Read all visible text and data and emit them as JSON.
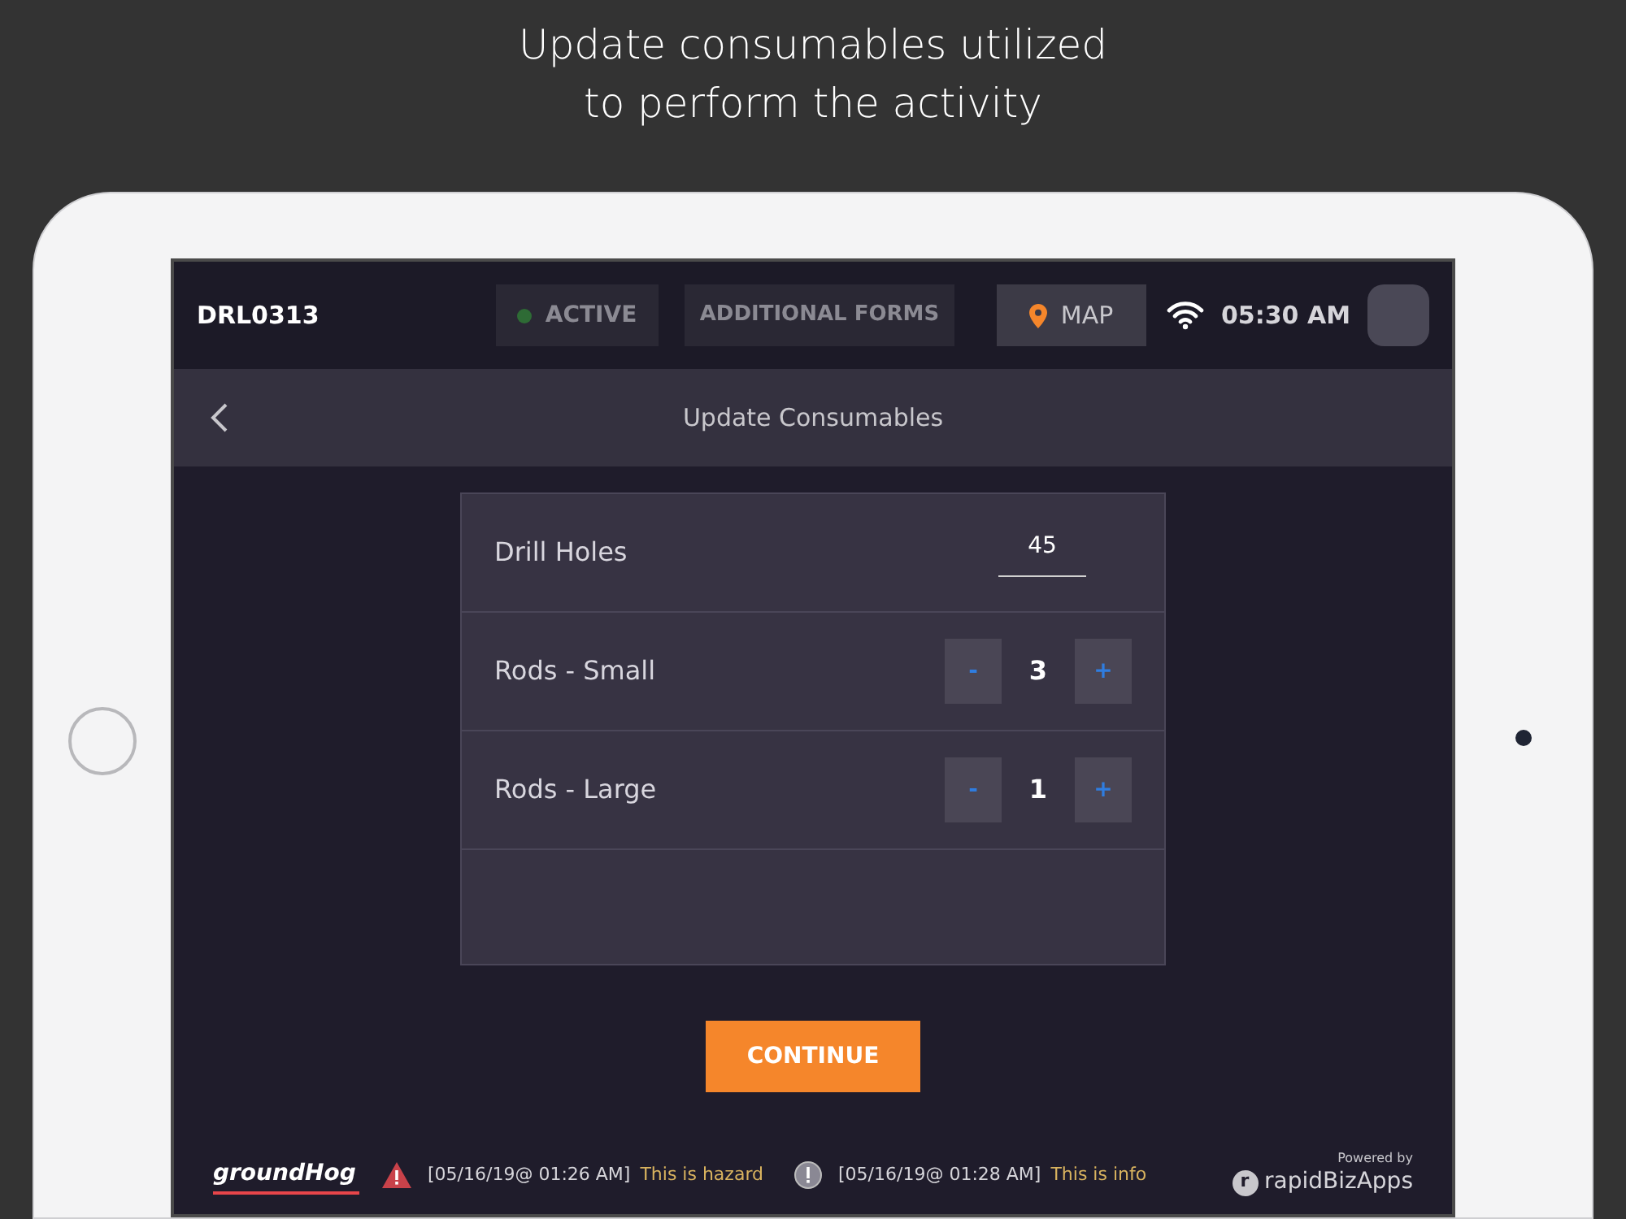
{
  "caption": [
    "Update consumables utilized",
    "to perform the activity"
  ],
  "top_bar": {
    "id": "DRL0313",
    "status": {
      "label": "ACTIVE",
      "color": "#2e6b35"
    },
    "forms_button": "ADDITIONAL FORMS",
    "map_button": "MAP",
    "time": "05:30 AM"
  },
  "header": {
    "title": "Update Consumables"
  },
  "consumables": [
    {
      "kind": "input",
      "name": "Drill Holes",
      "value": "45"
    },
    {
      "kind": "stepper",
      "name": "Rods - Small",
      "value": "3",
      "minus": "-",
      "plus": "+"
    },
    {
      "kind": "stepper",
      "name": "Rods - Large",
      "value": "1",
      "minus": "-",
      "plus": "+"
    }
  ],
  "continue_button": "CONTINUE",
  "footer": {
    "logo": "groundHog",
    "alerts": [
      {
        "kind": "hazard",
        "time": "[05/16/19@ 01:26 AM]",
        "message": "This is hazard"
      },
      {
        "kind": "info",
        "time": "[05/16/19@ 01:28 AM]",
        "message": "This is info"
      }
    ],
    "powered_by": "Powered by",
    "brand": "rapidBizApps",
    "brand_mark": "r"
  }
}
